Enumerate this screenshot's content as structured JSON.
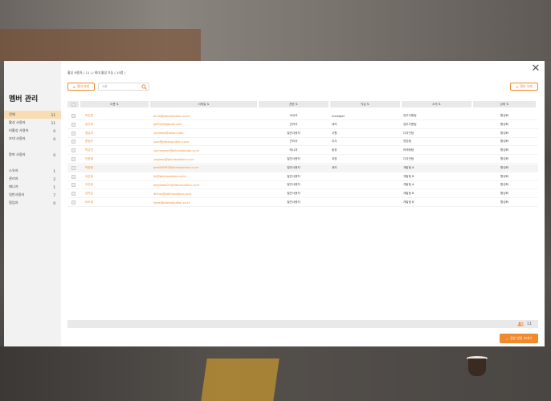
{
  "modal": {
    "title": "멤버 관리",
    "close_icon": "close-icon"
  },
  "sidebar": {
    "groups": [
      [
        {
          "label": "전체",
          "count": "11",
          "active": true
        },
        {
          "label": "활성 사용자",
          "count": "11"
        },
        {
          "label": "비활성 사용자",
          "count": "0"
        },
        {
          "label": "초대 사용자",
          "count": "0"
        }
      ],
      [
        {
          "label": "탈퇴 사용자",
          "count": "0"
        }
      ],
      [
        {
          "label": "소유자",
          "count": "1"
        },
        {
          "label": "관리자",
          "count": "2"
        },
        {
          "label": "매니저",
          "count": "1"
        },
        {
          "label": "일반사용자",
          "count": "7"
        },
        {
          "label": "협업자",
          "count": "0"
        }
      ]
    ]
  },
  "main": {
    "info": "활성 사용자 ( 11 ) / 최대 활성 가능 ( 10명 )",
    "invite_button": "멤버 초대",
    "search_placeholder": "이름",
    "delete_button": "멤버 삭제",
    "columns": [
      "이름",
      "이메일",
      "권한",
      "직급",
      "소속",
      "상태"
    ],
    "rows": [
      {
        "name": "박진현",
        "email": "anna@pitchsolution.co.kr",
        "role": "소유자",
        "title": "manager",
        "dept": "업무지원팀",
        "status": "활성화"
      },
      {
        "name": "장주희",
        "email": "jjohmin@gmail.com",
        "role": "관리자",
        "title": "대리",
        "dept": "업무지원팀",
        "status": "활성화"
      },
      {
        "name": "정유미",
        "email": "yumiseo@naver.com",
        "role": "일반사용자",
        "title": "사원",
        "dept": "디자인팀",
        "status": "활성화"
      },
      {
        "name": "한영도",
        "email": "juan@pitchsolution.co.kr",
        "role": "관리자",
        "title": "이사",
        "dept": "영업팀",
        "status": "활성화"
      },
      {
        "name": "박유진",
        "email": "connorpark@pitchsolution.co.kr",
        "role": "매니저",
        "title": "팀장",
        "dept": "마케팅팀",
        "status": "활성화"
      },
      {
        "name": "안윤채",
        "email": "yoojeon@pitchsolution.co.kr",
        "role": "일반사용자",
        "title": "과장",
        "dept": "디자인팀",
        "status": "활성화"
      },
      {
        "name": "박정현",
        "email": "park06492@pitchsolution.co.kr",
        "role": "일반사용자",
        "title": "대리",
        "dept": "개발팀 A",
        "status": "활성화",
        "highlight": true
      },
      {
        "name": "이은정",
        "email": "lej@pitchsolution.co.kr",
        "role": "일반사용자",
        "title": "",
        "dept": "개발팀 B",
        "status": "활성화"
      },
      {
        "name": "조은정",
        "email": "windreek01@pitchsolution.co.kr",
        "role": "일반사용자",
        "title": "",
        "dept": "개발팀 A",
        "status": "활성화"
      },
      {
        "name": "강지은",
        "email": "dhkim@pitchsolution.co.kr",
        "role": "일반사용자",
        "title": "",
        "dept": "개발팀 B",
        "status": "활성화"
      },
      {
        "name": "이도재",
        "email": "hjlee@pitchsolution.co.kr",
        "role": "일반사용자",
        "title": "",
        "dept": "개발팀 B",
        "status": "활성화"
      }
    ],
    "footer_count": "11",
    "save_button": "권한 변경 보내기"
  },
  "colors": {
    "accent": "#f08a2c",
    "active_bg": "#f7ddb1"
  }
}
